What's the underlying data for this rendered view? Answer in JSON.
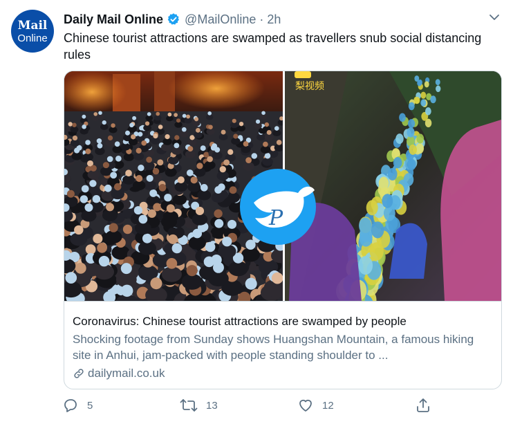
{
  "account": {
    "avatar_line1": "Mail",
    "avatar_line2": "Online",
    "name": "Daily Mail Online",
    "handle": "@MailOnline",
    "separator": "·",
    "time": "2h"
  },
  "tweet": {
    "text": "Chinese tourist attractions are swamped as travellers snub social distancing rules"
  },
  "card": {
    "media_caption": "梨视频",
    "title": "Coronavirus: Chinese tourist attractions are swamped by people",
    "description": "Shocking footage from Sunday shows Huangshan Mountain, a famous hiking site in Anhui, jam-packed with people standing shoulder to ...",
    "domain": "dailymail.co.uk"
  },
  "actions": {
    "replies": "5",
    "retweets": "13",
    "likes": "12"
  },
  "icons": {
    "verified": "verified-badge-icon",
    "more": "chevron-down-icon",
    "reply": "reply-icon",
    "retweet": "retweet-icon",
    "like": "heart-icon",
    "share": "share-icon",
    "link": "link-icon"
  },
  "colors": {
    "verified": "#1da1f2",
    "secondary_text": "#5b7083",
    "avatar_bg": "#0a4ea8",
    "watermark_bird": "#1da1f2"
  }
}
